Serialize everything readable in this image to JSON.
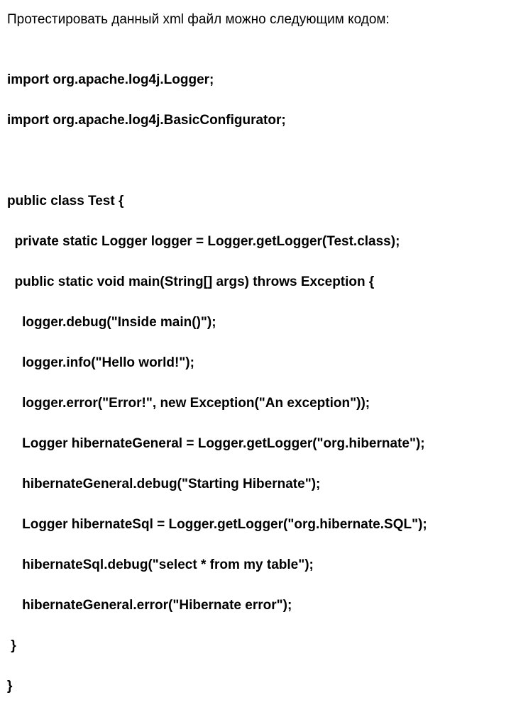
{
  "intro": "Протестировать данный xml файл можно следующим кодом:",
  "code": {
    "l01": "import org.apache.log4j.Logger;",
    "l02": "import org.apache.log4j.BasicConfigurator;",
    "l03": "public class Test {",
    "l04": "  private static Logger logger = Logger.getLogger(Test.class);",
    "l05": "  public static void main(String[] args) throws Exception {",
    "l06": "    logger.debug(\"Inside main()\");",
    "l07": "    logger.info(\"Hello world!\");",
    "l08": "    logger.error(\"Error!\", new Exception(\"An exception\"));",
    "l09": "    Logger hibernateGeneral = Logger.getLogger(\"org.hibernate\");",
    "l10": "    hibernateGeneral.debug(\"Starting Hibernate\");",
    "l11": "    Logger hibernateSql = Logger.getLogger(\"org.hibernate.SQL\");",
    "l12": "    hibernateSql.debug(\"select * from my table\");",
    "l13": "    hibernateGeneral.error(\"Hibernate error\");",
    "l14": " }",
    "l15": "}"
  }
}
